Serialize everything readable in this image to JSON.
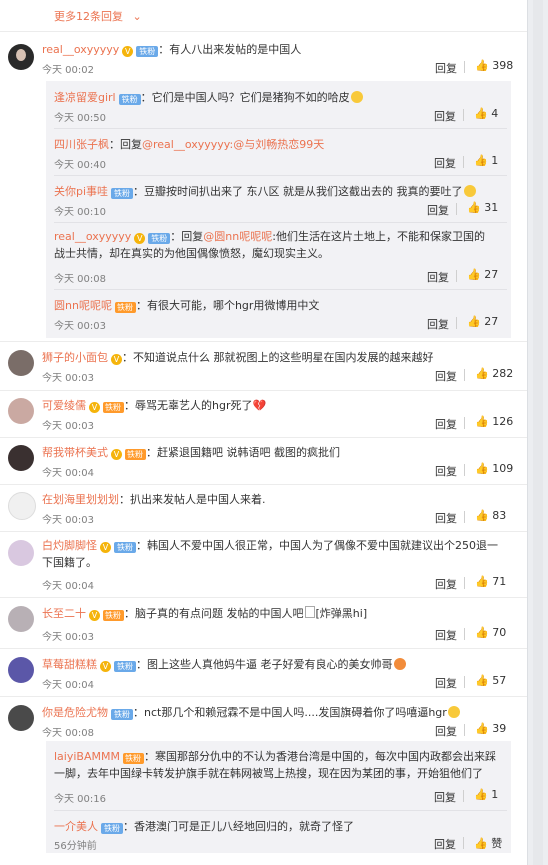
{
  "more_replies": "更多12条回复",
  "reply_label": "回复",
  "like_label": "赞",
  "comments": [
    {
      "user": "real__oxyyyyy",
      "text": "：有人八出来发帖的是中国人",
      "time": "今天 00:02",
      "likes": "398"
    },
    {
      "user": "逢凉留爱girl",
      "text": "：它们是中国人吗？它们是猪狗不如的哈皮",
      "time": "今天 00:50",
      "likes": "4"
    },
    {
      "user": "四川张子枫",
      "text_a": "：回复",
      "mention": "@real__oxyyyyy",
      "text_b": ":@与刘畅热恋99天",
      "time": "今天 00:40",
      "likes": "1"
    },
    {
      "user": "关你pi事哇",
      "text": "：豆瓣按时间扒出来了 东八区 就是从我们这截出去的 我真的要吐了",
      "time": "今天 00:10",
      "likes": "31"
    },
    {
      "user": "real__oxyyyyy",
      "text_a": "：回复",
      "mention": "@圆nn呢呢呢",
      "text_b": ":他们生活在这片土地上，不能和保家卫国的战士共情，却在真实的为他国偶像愤怒，魔幻现实主义。",
      "time": "今天 00:08",
      "likes": "27"
    },
    {
      "user": "圆nn呢呢呢",
      "text": "：有很大可能，哪个hgr用微博用中文",
      "time": "今天 00:03",
      "likes": "27"
    },
    {
      "user": "狮子的小面包",
      "text": "：不知道说点什么 那就祝图上的这些明星在国内发展的越来越好",
      "time": "今天 00:03",
      "likes": "282"
    },
    {
      "user": "可爱绫儒",
      "text": "：辱骂无辜艺人的hgr死了",
      "time": "今天 00:03",
      "likes": "126"
    },
    {
      "user": "帮我带杯美式",
      "text": "：赶紧退国籍吧 说韩语吧 截图的疯批们",
      "time": "今天 00:04",
      "likes": "109"
    },
    {
      "user": "在划海里划划划",
      "text": "：扒出来发帖人是中国人来着.",
      "time": "今天 00:03",
      "likes": "83"
    },
    {
      "user": "白灼脚脚怪",
      "text": "：韩国人不爱中国人很正常，中国人为了偶像不爱中国就建议出个250退一下国籍了。",
      "time": "今天 00:04",
      "likes": "71"
    },
    {
      "user": "长至二十",
      "text": "：脑子真的有点问题 发帖的中国人吧",
      "img_alt": "[炸弹黑hi]",
      "time": "今天 00:03",
      "likes": "70"
    },
    {
      "user": "草莓甜糕糕",
      "text": "：图上这些人真他妈牛逼 老子好爱有良心的美女帅哥",
      "time": "今天 00:04",
      "likes": "57"
    },
    {
      "user": "你是危险尤物",
      "text": "：nct那几个和赖冠霖不是中国人吗....发国旗碍着你了吗嘻逼hgr",
      "time": "今天 00:08",
      "likes": "39"
    },
    {
      "user": "laiyiBAMMM",
      "text": "：寒国那部分仇中的不认为香港台湾是中国的，每次中国内政都会出来踩一脚，去年中国绿卡转发护旗手就在韩网被骂上热搜，现在因为某团的事，开始狙他们了",
      "time": "今天 00:16",
      "likes": "1"
    },
    {
      "user": "一介美人",
      "text": "：香港澳门可是正儿八经地回归的，就奇了怪了",
      "time": "56分钟前",
      "likes": "赞"
    }
  ],
  "badges": {
    "fan": "铁粉",
    "hot": "铁粉"
  },
  "colors": {
    "accent": "#eb7350",
    "badge_blue": "#6aa9e9",
    "badge_gold": "#f5b40b",
    "sub_bg": "#f2f2f5"
  }
}
